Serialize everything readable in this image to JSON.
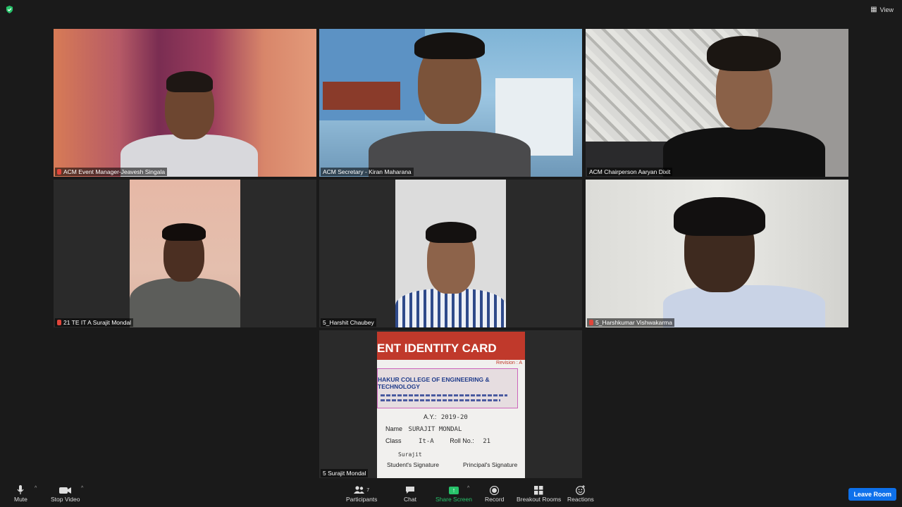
{
  "topbar": {
    "view_label": "View"
  },
  "tiles": [
    {
      "name": "ACM Event Manager-Jeavesh Singala",
      "muted": true
    },
    {
      "name": "ACM Secretary - Kiran Maharana",
      "muted": false,
      "active": true
    },
    {
      "name": "ACM Chairperson Aaryan Dixit",
      "muted": false
    },
    {
      "name": "21 TE IT A Surajit Mondal",
      "muted": true
    },
    {
      "name": "5_Harshit Chaubey",
      "muted": false
    },
    {
      "name": "5_Harshkumar Vishwakarma",
      "muted": true
    },
    {
      "name": "5 Surajit Mondal",
      "muted": false
    }
  ],
  "id_card": {
    "title": "ENT IDENTITY CARD",
    "revision": "Revision : A",
    "college": "HAKUR COLLEGE OF ENGINEERING & TECHNOLOGY",
    "ay_label": "A.Y.:",
    "ay_value": "2019-20",
    "name_label": "Name",
    "name_value": "SURAJIT MONDAL",
    "class_label": "Class",
    "class_value": "It-A",
    "roll_label": "Roll No.:",
    "roll_value": "21",
    "sign_value": "Surajit",
    "student_sig": "Student's Signature",
    "principal_sig": "Principal's Signature"
  },
  "toolbar": {
    "mute": "Mute",
    "stop_video": "Stop Video",
    "participants": "Participants",
    "participants_count": "7",
    "chat": "Chat",
    "share_screen": "Share Screen",
    "record": "Record",
    "breakout": "Breakout Rooms",
    "reactions": "Reactions",
    "leave": "Leave Room"
  }
}
